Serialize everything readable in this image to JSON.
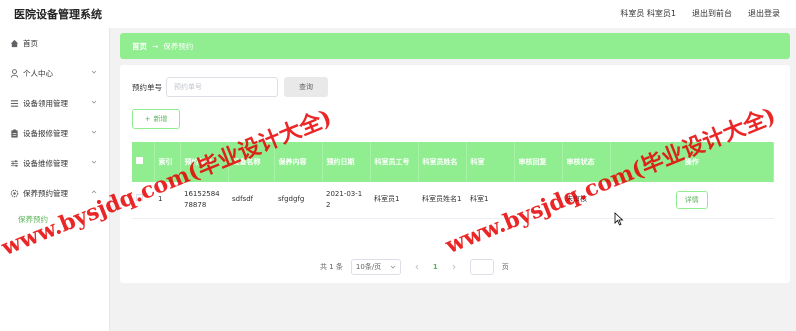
{
  "app": {
    "title": "医院设备管理系统"
  },
  "topbar": {
    "role": "科室员",
    "user": "科室员1",
    "frontend_link": "退出到前台",
    "logout_link": "退出登录"
  },
  "sidebar": {
    "items": [
      {
        "label": "首页",
        "icon": "home-icon",
        "has_children": false
      },
      {
        "label": "个人中心",
        "icon": "user-icon",
        "has_children": true
      },
      {
        "label": "设备领用管理",
        "icon": "list-icon",
        "has_children": true
      },
      {
        "label": "设备报修管理",
        "icon": "clipboard-icon",
        "has_children": true
      },
      {
        "label": "设备维修管理",
        "icon": "sliders-icon",
        "has_children": true
      },
      {
        "label": "保养预约管理",
        "icon": "gear-icon",
        "has_children": true,
        "expanded": true
      }
    ],
    "sub_items": [
      {
        "label": "保养预约"
      }
    ]
  },
  "breadcrumb": {
    "home": "首页",
    "separator": "→",
    "current": "保养预约"
  },
  "search": {
    "label": "预约单号",
    "placeholder": "预约单号",
    "button": "查询"
  },
  "toolbar": {
    "add_label": "新增",
    "add_icon": "plus-icon"
  },
  "table": {
    "headers": [
      "索引",
      "预约单号",
      "设备名称",
      "保养内容",
      "预约日期",
      "科室员工号",
      "科室员姓名",
      "科室",
      "审核回复",
      "审核状态",
      "操作"
    ],
    "rows": [
      {
        "index": "1",
        "order_no": "1615258478878",
        "device": "sdfsdf",
        "content": "sfgdgfg",
        "date": "2021-03-12",
        "staff_no": "科室员1",
        "staff_name": "科室员姓名1",
        "dept": "科室1",
        "reply": "",
        "status": "未审核",
        "action": "详情"
      }
    ]
  },
  "pagination": {
    "total": "共 1 条",
    "page_size": "10条/页",
    "current_page": "1",
    "goto_suffix": "页"
  },
  "watermark": {
    "text": "www.bysjdq.com(毕业设计大全)"
  },
  "colors": {
    "accent": "#90ee90",
    "accent_text": "#5ab55a",
    "watermark": "#e60000"
  }
}
